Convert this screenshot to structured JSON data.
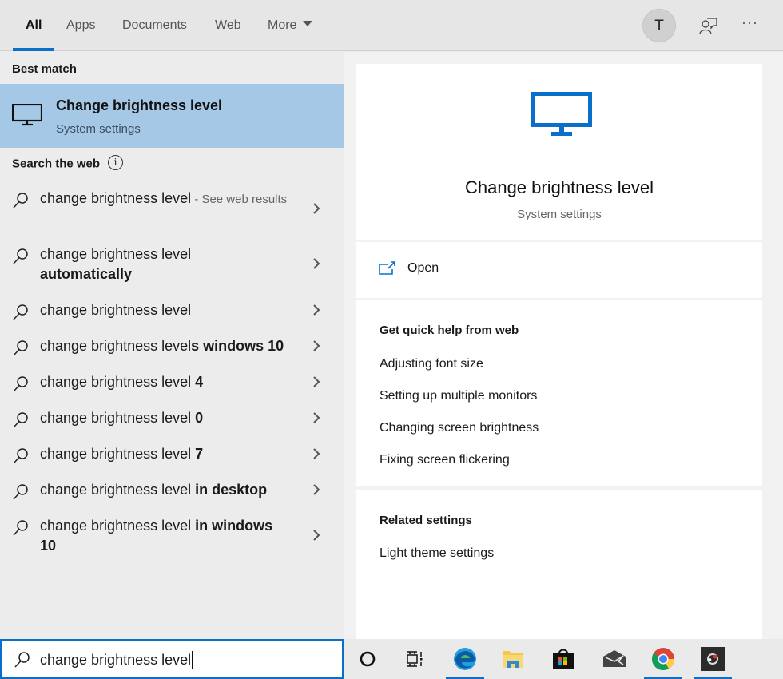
{
  "tabs": [
    {
      "label": "All",
      "active": true
    },
    {
      "label": "Apps"
    },
    {
      "label": "Documents"
    },
    {
      "label": "Web"
    },
    {
      "label": "More"
    }
  ],
  "header": {
    "avatar_initial": "T",
    "feedback_icon": "feedback-person-icon",
    "more_label": "···"
  },
  "left": {
    "best_match_label": "Best match",
    "best_match": {
      "icon": "monitor-icon",
      "title": "Change brightness level",
      "subtitle": "System settings"
    },
    "search_web_label": "Search the web",
    "info_glyph": "i",
    "web_results": [
      {
        "normal": "change brightness level",
        "bold": "",
        "small": " - See web results"
      },
      {
        "normal": "change brightness level",
        "bold": "automatically",
        "small": ""
      },
      {
        "normal": "change brightness level",
        "bold": "",
        "small": ""
      },
      {
        "normal": "change brightness level",
        "bold": "s windows 10",
        "small": ""
      },
      {
        "normal": "change brightness level",
        "bold": " 4",
        "small": ""
      },
      {
        "normal": "change brightness level",
        "bold": " 0",
        "small": ""
      },
      {
        "normal": "change brightness level",
        "bold": " 7",
        "small": ""
      },
      {
        "normal": "change brightness level",
        "bold": " in desktop",
        "small": ""
      },
      {
        "normal": "change brightness level",
        "bold": " in windows 10",
        "small": ""
      }
    ]
  },
  "right": {
    "hero_title": "Change brightness level",
    "hero_subtitle": "System settings",
    "open_label": "Open",
    "quick_help_heading": "Get quick help from web",
    "quick_help_links": [
      "Adjusting font size",
      "Setting up multiple monitors",
      "Changing screen brightness",
      "Fixing screen flickering"
    ],
    "related_heading": "Related settings",
    "related_links": [
      "Light theme settings"
    ]
  },
  "search": {
    "value": "change brightness level"
  },
  "taskbar": {
    "items": [
      {
        "name": "cortana",
        "running": false
      },
      {
        "name": "task-view",
        "running": false
      },
      {
        "name": "edge",
        "running": true
      },
      {
        "name": "file-explorer",
        "running": false
      },
      {
        "name": "microsoft-store",
        "running": false
      },
      {
        "name": "mail",
        "running": false
      },
      {
        "name": "chrome",
        "running": true
      },
      {
        "name": "obs",
        "running": true
      }
    ]
  },
  "colors": {
    "accent": "#0a6fcb",
    "selection": "#a5c8e6"
  }
}
